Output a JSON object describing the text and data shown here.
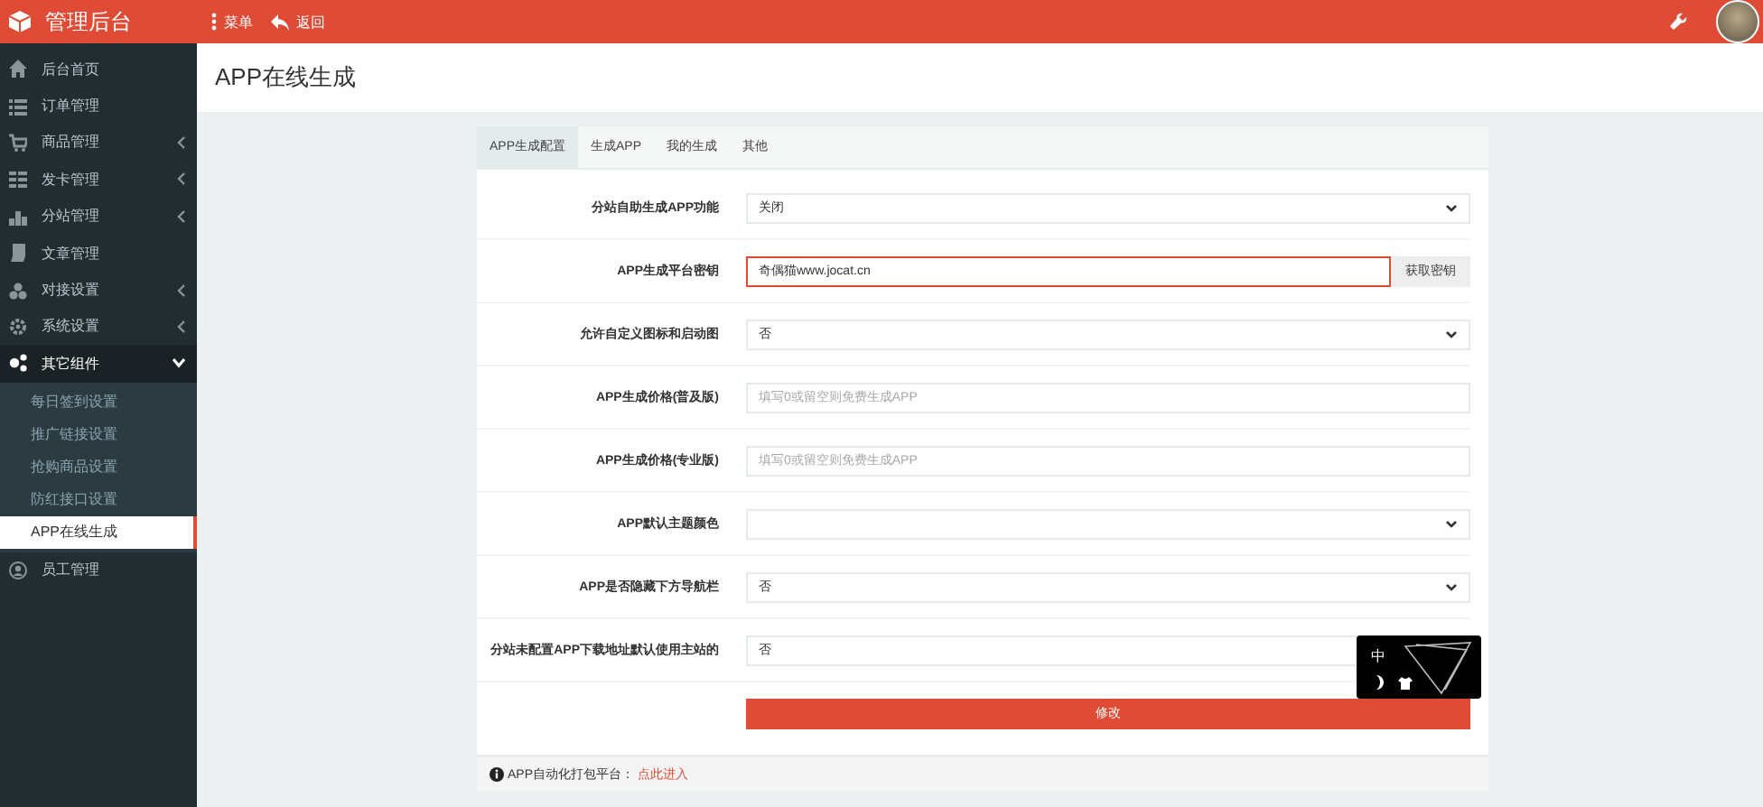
{
  "topbar": {
    "brand": "管理后台",
    "menu": "菜单",
    "back": "返回"
  },
  "sidebar": {
    "items": [
      {
        "label": "后台首页",
        "kind": "link",
        "selected": false
      },
      {
        "label": "订单管理",
        "kind": "link",
        "selected": false
      },
      {
        "label": "商品管理",
        "kind": "group",
        "expanded": false,
        "selected": false
      },
      {
        "label": "发卡管理",
        "kind": "group",
        "expanded": false,
        "selected": false
      },
      {
        "label": "分站管理",
        "kind": "group",
        "expanded": false,
        "selected": false
      },
      {
        "label": "文章管理",
        "kind": "link",
        "selected": false
      },
      {
        "label": "对接设置",
        "kind": "group",
        "expanded": false,
        "selected": false
      },
      {
        "label": "系统设置",
        "kind": "group",
        "expanded": false,
        "selected": false
      },
      {
        "label": "其它组件",
        "kind": "group",
        "expanded": true,
        "selected": false,
        "children": [
          {
            "label": "每日签到设置",
            "selected": false
          },
          {
            "label": "推广链接设置",
            "selected": false
          },
          {
            "label": "抢购商品设置",
            "selected": false
          },
          {
            "label": "防红接口设置",
            "selected": false
          },
          {
            "label": "APP在线生成",
            "selected": true
          }
        ]
      },
      {
        "label": "员工管理",
        "kind": "link",
        "selected": false
      }
    ]
  },
  "page": {
    "title": "APP在线生成"
  },
  "tabs": [
    {
      "label": "APP生成配置",
      "selected": true
    },
    {
      "label": "生成APP",
      "selected": false
    },
    {
      "label": "我的生成",
      "selected": false
    },
    {
      "label": "其他",
      "selected": false
    }
  ],
  "form": {
    "rows": [
      {
        "label": "分站自助生成APP功能",
        "kind": "select",
        "value": "关闭",
        "focused": false
      },
      {
        "label": "APP生成平台密钥",
        "kind": "input",
        "value": "奇偶猫www.jocat.cn",
        "focused": true,
        "addon": "获取密钥"
      },
      {
        "label": "允许自定义图标和启动图",
        "kind": "select",
        "value": "否",
        "focused": false
      },
      {
        "label": "APP生成价格(普及版)",
        "kind": "input",
        "placeholder": "填写0或留空则免费生成APP",
        "focused": false
      },
      {
        "label": "APP生成价格(专业版)",
        "kind": "input",
        "placeholder": "填写0或留空则免费生成APP",
        "focused": false
      },
      {
        "label": "APP默认主题颜色",
        "kind": "select",
        "focused": false
      },
      {
        "label": "APP是否隐藏下方导航栏",
        "kind": "select",
        "value": "否",
        "focused": false
      },
      {
        "label": "分站未配置APP下载地址默认使用主站的",
        "kind": "select",
        "value": "否",
        "focused": false
      }
    ],
    "submit": "修改"
  },
  "footer": {
    "text": "APP自动化打包平台：",
    "link": "点此进入"
  },
  "ime_widget": {
    "mode": "中"
  }
}
